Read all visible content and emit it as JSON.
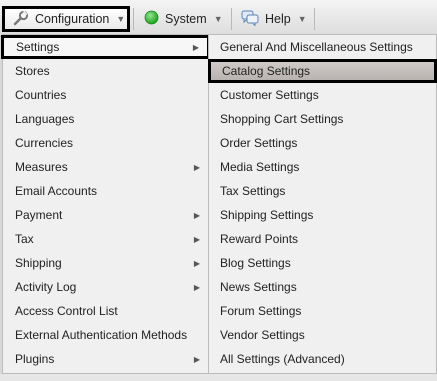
{
  "menubar": {
    "configuration": "Configuration",
    "system": "System",
    "help": "Help"
  },
  "config_menu": [
    {
      "label": "Settings",
      "submenu": true
    },
    {
      "label": "Stores",
      "submenu": false
    },
    {
      "label": "Countries",
      "submenu": false
    },
    {
      "label": "Languages",
      "submenu": false
    },
    {
      "label": "Currencies",
      "submenu": false
    },
    {
      "label": "Measures",
      "submenu": true
    },
    {
      "label": "Email Accounts",
      "submenu": false
    },
    {
      "label": "Payment",
      "submenu": true
    },
    {
      "label": "Tax",
      "submenu": true
    },
    {
      "label": "Shipping",
      "submenu": true
    },
    {
      "label": "Activity Log",
      "submenu": true
    },
    {
      "label": "Access Control List",
      "submenu": false
    },
    {
      "label": "External Authentication Methods",
      "submenu": false
    },
    {
      "label": "Plugins",
      "submenu": true
    }
  ],
  "settings_submenu": [
    "General And Miscellaneous Settings",
    "Catalog Settings",
    "Customer Settings",
    "Shopping Cart Settings",
    "Order Settings",
    "Media Settings",
    "Tax Settings",
    "Shipping Settings",
    "Reward Points",
    "Blog Settings",
    "News Settings",
    "Forum Settings",
    "Vendor Settings",
    "All Settings (Advanced)"
  ],
  "colors": {
    "highlight_border": "#000000",
    "catalog_highlight": "#c4bfbc",
    "system_status": "#2fb52f"
  }
}
